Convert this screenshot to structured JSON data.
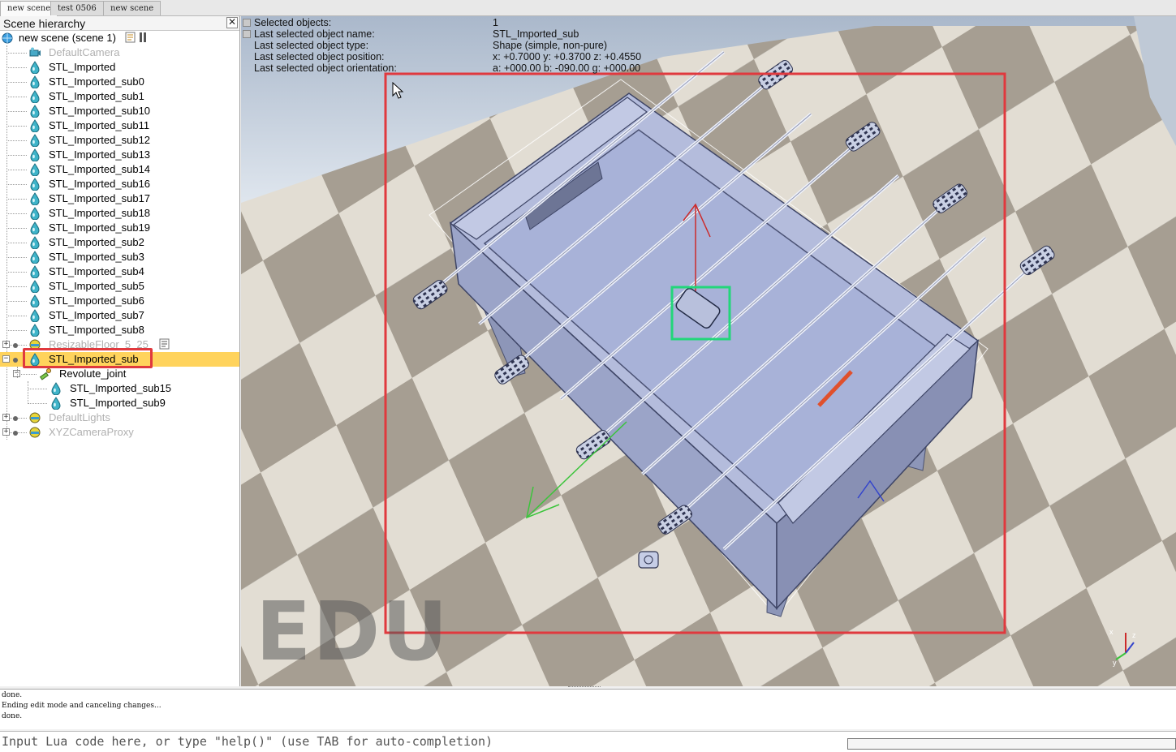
{
  "tabs": [
    {
      "label": "new scene",
      "active": true
    },
    {
      "label": "test 0506",
      "active": false
    },
    {
      "label": "new scene",
      "active": false
    }
  ],
  "hierarchy": {
    "title": "Scene hierarchy",
    "close_label": "✕",
    "root_label": "new scene (scene 1)",
    "items": [
      {
        "label": "DefaultCamera",
        "icon": "camera-icon",
        "dim": true
      },
      {
        "label": "STL_Imported",
        "icon": "shape-icon"
      },
      {
        "label": "STL_Imported_sub0",
        "icon": "shape-icon"
      },
      {
        "label": "STL_Imported_sub1",
        "icon": "shape-icon"
      },
      {
        "label": "STL_Imported_sub10",
        "icon": "shape-icon"
      },
      {
        "label": "STL_Imported_sub11",
        "icon": "shape-icon"
      },
      {
        "label": "STL_Imported_sub12",
        "icon": "shape-icon"
      },
      {
        "label": "STL_Imported_sub13",
        "icon": "shape-icon"
      },
      {
        "label": "STL_Imported_sub14",
        "icon": "shape-icon"
      },
      {
        "label": "STL_Imported_sub16",
        "icon": "shape-icon"
      },
      {
        "label": "STL_Imported_sub17",
        "icon": "shape-icon"
      },
      {
        "label": "STL_Imported_sub18",
        "icon": "shape-icon"
      },
      {
        "label": "STL_Imported_sub19",
        "icon": "shape-icon"
      },
      {
        "label": "STL_Imported_sub2",
        "icon": "shape-icon"
      },
      {
        "label": "STL_Imported_sub3",
        "icon": "shape-icon"
      },
      {
        "label": "STL_Imported_sub4",
        "icon": "shape-icon"
      },
      {
        "label": "STL_Imported_sub5",
        "icon": "shape-icon"
      },
      {
        "label": "STL_Imported_sub6",
        "icon": "shape-icon"
      },
      {
        "label": "STL_Imported_sub7",
        "icon": "shape-icon"
      },
      {
        "label": "STL_Imported_sub8",
        "icon": "shape-icon"
      },
      {
        "label": "ResizableFloor_5_25",
        "icon": "floor-icon",
        "dim": true
      },
      {
        "label": "STL_Imported_sub",
        "icon": "shape-icon",
        "selected": true
      },
      {
        "label": "Revolute_joint",
        "icon": "joint-icon"
      },
      {
        "label": "STL_Imported_sub15",
        "icon": "shape-icon"
      },
      {
        "label": "STL_Imported_sub9",
        "icon": "shape-icon"
      },
      {
        "label": "DefaultLights",
        "icon": "light-icon",
        "dim": true
      },
      {
        "label": "XYZCameraProxy",
        "icon": "light-icon",
        "dim": true
      }
    ]
  },
  "info": {
    "rows": [
      {
        "label": "Selected objects:",
        "value": "1"
      },
      {
        "label": "Last selected object name:",
        "value": "STL_Imported_sub"
      },
      {
        "label": "Last selected object type:",
        "value": "Shape (simple, non-pure)"
      },
      {
        "label": "Last selected object position:",
        "value": "x: +0.7000   y: +0.3700   z: +0.4550"
      },
      {
        "label": "Last selected object orientation:",
        "value": "a: +000.00   b: -090.00   g: +000.00"
      }
    ]
  },
  "watermark": "EDU",
  "axis_labels": {
    "x": "x",
    "y": "y",
    "z": "z"
  },
  "console": {
    "lines": [
      "done.",
      "Ending edit mode and canceling changes...",
      "done."
    ],
    "placeholder": "Input Lua code here, or type \"help()\" (use TAB for auto-completion)"
  },
  "colors": {
    "selected_row": "#ffd35c",
    "highlight_red": "#e0393e",
    "highlight_green": "#22d67a",
    "table": "#a9b3d6",
    "floor_light": "#e4dfd6",
    "floor_dark": "#a59d91"
  }
}
